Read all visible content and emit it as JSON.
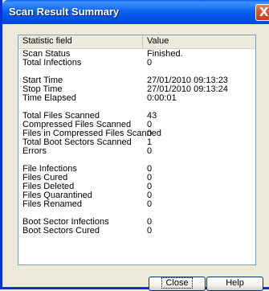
{
  "window": {
    "title": "Scan Result Summary",
    "close_glyph": "X"
  },
  "table": {
    "headers": [
      "Statistic field",
      "Value"
    ],
    "rows": [
      {
        "field": "Scan Status",
        "value": "Finished."
      },
      {
        "field": "Total Infections",
        "value": "0"
      },
      {
        "field": "",
        "value": ""
      },
      {
        "field": "Start Time",
        "value": "27/01/2010 09:13:23"
      },
      {
        "field": "Stop Time",
        "value": "27/01/2010 09:13:24"
      },
      {
        "field": "Time Elapsed",
        "value": "0:00:01"
      },
      {
        "field": "",
        "value": ""
      },
      {
        "field": "Total Files Scanned",
        "value": "43"
      },
      {
        "field": "Compressed Files Scanned",
        "value": "0"
      },
      {
        "field": "Files in Compressed Files Scanned",
        "value": "0"
      },
      {
        "field": "Total Boot Sectors Scanned",
        "value": "1"
      },
      {
        "field": "Errors",
        "value": "0"
      },
      {
        "field": "",
        "value": ""
      },
      {
        "field": "File Infections",
        "value": "0"
      },
      {
        "field": "Files Cured",
        "value": "0"
      },
      {
        "field": "Files Deleted",
        "value": "0"
      },
      {
        "field": "Files Quarantined",
        "value": "0"
      },
      {
        "field": "Files Renamed",
        "value": "0"
      },
      {
        "field": "",
        "value": ""
      },
      {
        "field": "Boot Sector Infections",
        "value": "0"
      },
      {
        "field": "Boot Sectors Cured",
        "value": "0"
      }
    ]
  },
  "buttons": {
    "close": "Close",
    "help": "Help"
  }
}
